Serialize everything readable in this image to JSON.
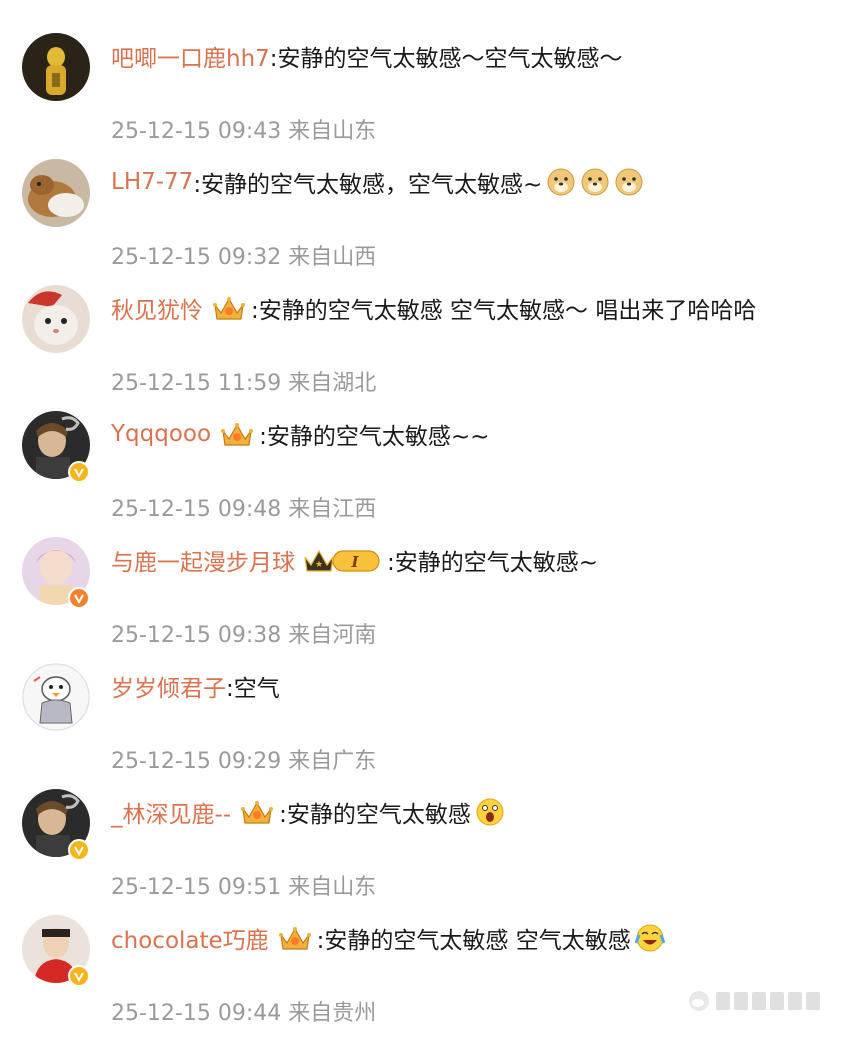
{
  "comments": [
    {
      "username": "吧唧一口鹿hh7",
      "text": ":安静的空气太敏感～空气太敏感～",
      "meta": "25-12-15 09:43 来自山东",
      "avatar": "avatar-yellow-figure"
    },
    {
      "username": "LH7-77",
      "text": ":安静的空气太敏感，空气太敏感~",
      "meta": "25-12-15 09:32 来自山西",
      "avatar": "avatar-cat",
      "emoji": "doge-emoji"
    },
    {
      "username": "秋见犹怜",
      "text": ":安静的空气太敏感 空气太敏感～ 唱出来了哈哈哈",
      "meta": "25-12-15 11:59 来自湖北",
      "avatar": "avatar-hamster",
      "badge": "crown-badge"
    },
    {
      "username": "Yqqqooo",
      "text": ":安静的空气太敏感~~",
      "meta": "25-12-15 09:48 来自江西",
      "avatar": "avatar-smoking-man",
      "badge": "crown-badge",
      "verified": "yellow"
    },
    {
      "username": "与鹿一起漫步月球",
      "text": ":安静的空气太敏感~",
      "meta": "25-12-15 09:38 来自河南",
      "avatar": "avatar-pink-hair",
      "badge": "vip-level-badge",
      "badge_text": "I",
      "verified": "orange"
    },
    {
      "username": "岁岁倾君子",
      "text": ":空气",
      "meta": "25-12-15 09:29 来自广东",
      "avatar": "avatar-cartoon-duck"
    },
    {
      "username": "_林深见鹿--",
      "text": ":安静的空气太敏感",
      "meta": "25-12-15 09:51 来自山东",
      "avatar": "avatar-smoking-man",
      "badge": "crown-badge",
      "verified": "yellow",
      "emoji": "surprised-emoji"
    },
    {
      "username": "chocolate巧鹿",
      "text": ":安静的空气太敏感 空气太敏感",
      "meta": "25-12-15 09:44 来自贵州",
      "avatar": "avatar-red-shirt",
      "badge": "crown-badge",
      "verified": "yellow",
      "emoji": "crying-laugh-emoji"
    }
  ],
  "colors": {
    "username": "#d9734f",
    "text": "#1a1a1a",
    "meta": "#9a9a9a",
    "verified_yellow": "#f5b51b",
    "verified_orange": "#f08332"
  }
}
